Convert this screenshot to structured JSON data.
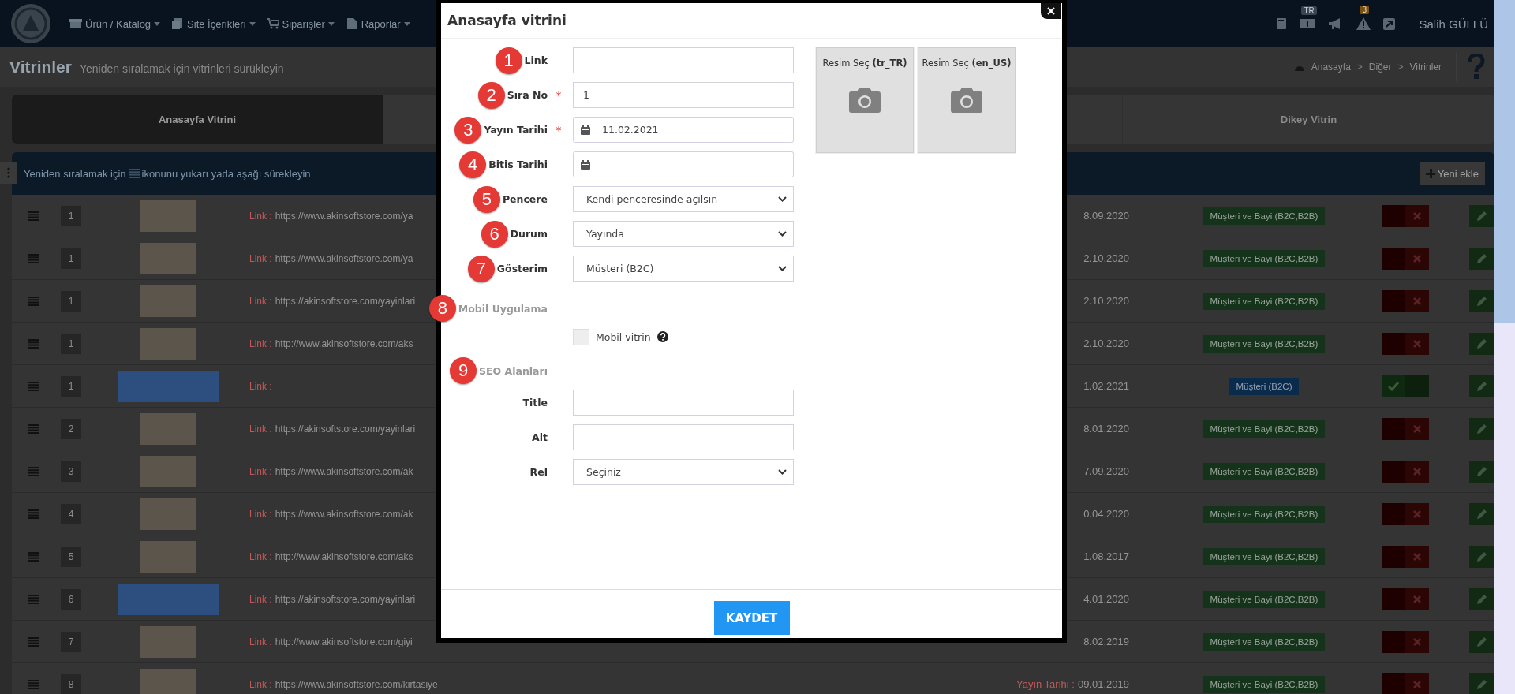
{
  "navbar": {
    "menu": [
      {
        "label": "Ürün / Katalog"
      },
      {
        "label": "Site İçerikleri"
      },
      {
        "label": "Siparişler"
      },
      {
        "label": "Raporlar"
      }
    ],
    "language_badge": "TR",
    "alert_count": "3",
    "user_name": "Salih GÜLLÜ"
  },
  "page_header": {
    "title": "Vitrinler",
    "subtitle": "Yeniden sıralamak için vitrinleri sürükleyin",
    "breadcrumb": {
      "items": [
        "Anasayfa",
        "Diğer",
        "Vitrinler"
      ],
      "separator": ">"
    }
  },
  "tabs": [
    {
      "label": "Anasayfa Vitrini",
      "selected": true
    },
    {
      "label": "Dikey Vitrin",
      "selected": false
    }
  ],
  "list_header": {
    "hint_before": "Yeniden sıralamak için",
    "hint_after": "ikonunu yukarı yada aşağı sürekleyin",
    "add_button": "Yeni ekle"
  },
  "rows": [
    {
      "order": "1",
      "kind": "image",
      "link_label": "Link :",
      "link": "https://www.akinsoftstore.com/ya",
      "date": "8.09.2020",
      "audience": "Müşteri ve Bayi (B2C,B2B)",
      "color": "#15321a",
      "active": false
    },
    {
      "order": "1",
      "kind": "image",
      "link_label": "Link :",
      "link": "https://www.akinsoftstore.com/ya",
      "date": "2.10.2020",
      "audience": "Müşteri ve Bayi (B2C,B2B)",
      "color": "#15321a",
      "active": false
    },
    {
      "order": "1",
      "kind": "image",
      "link_label": "Link :",
      "link": "https://akinsoftstore.com/yayinlari",
      "date": "2.10.2020",
      "audience": "Müşteri ve Bayi (B2C,B2B)",
      "color": "#15321a",
      "active": false
    },
    {
      "order": "1",
      "kind": "image",
      "link_label": "Link :",
      "link": "http://www.akinsoftstore.com/aks",
      "date": "2.10.2020",
      "audience": "Müşteri ve Bayi (B2C,B2B)",
      "color": "#15321a",
      "active": false
    },
    {
      "order": "1",
      "kind": "banner",
      "link_label": "Link :",
      "date": "1.02.2021",
      "audience": "Müşteri (B2C)",
      "color": "#0b2b4d",
      "active": true
    },
    {
      "order": "2",
      "kind": "image",
      "link_label": "Link :",
      "link": "https://akinsoftstore.com/yayinlari",
      "date": "8.01.2020",
      "audience": "Müşteri ve Bayi (B2C,B2B)",
      "color": "#15321a",
      "active": false
    },
    {
      "order": "3",
      "kind": "image",
      "link_label": "Link :",
      "link": "https://www.akinsoftstore.com/ak",
      "date": "7.09.2020",
      "audience": "Müşteri ve Bayi (B2C,B2B)",
      "color": "#15321a",
      "active": false
    },
    {
      "order": "4",
      "kind": "image",
      "link_label": "Link :",
      "link": "https://www.akinsoftstore.com/ak",
      "date": "0.04.2020",
      "audience": "Müşteri ve Bayi (B2C,B2B)",
      "color": "#15321a",
      "active": false
    },
    {
      "order": "5",
      "kind": "image",
      "link_label": "Link :",
      "link": "http://www.akinsoftstore.com/aks",
      "date": "1.08.2017",
      "audience": "Müşteri ve Bayi (B2C,B2B)",
      "color": "#15321a",
      "active": false
    },
    {
      "order": "6",
      "kind": "banner",
      "link_label": "Link :",
      "link": "https://akinsoftstore.com/yayinlari",
      "date": "4.01.2020",
      "audience": "Müşteri ve Bayi (B2C,B2B)",
      "color": "#15321a",
      "active": false
    },
    {
      "order": "7",
      "kind": "image",
      "link_label": "Link :",
      "link": "http://www.akinsoftstore.com/giyi",
      "date": "8.02.2019",
      "audience": "Müşteri ve Bayi (B2C,B2B)",
      "color": "#15321a",
      "active": false
    },
    {
      "order": "8",
      "kind": "image",
      "link_label": "Link :",
      "link": "https://www.akinsoftstore.com/kirtasiye",
      "date_label": "Yayın Tarihi :",
      "date": "09.01.2019",
      "audience": "Müşteri ve Bayi (B2C,B2B)",
      "color": "#15321a",
      "active": false
    }
  ],
  "dialog": {
    "title": "Anasayfa vitrini",
    "required_mark": "*",
    "fields": [
      {
        "kind": "text",
        "marker": "1",
        "label": "Link",
        "required": false
      },
      {
        "kind": "text",
        "marker": "2",
        "label": "Sıra No",
        "required": true,
        "value": "1"
      },
      {
        "kind": "date",
        "marker": "3",
        "label": "Yayın Tarihi",
        "required": true,
        "value": "11.02.2021"
      },
      {
        "kind": "date",
        "marker": "4",
        "label": "Bitiş Tarihi",
        "required": false
      },
      {
        "kind": "select",
        "marker": "5",
        "label": "Pencere",
        "required": false,
        "value": "Kendi penceresinde açılsın"
      },
      {
        "kind": "select",
        "marker": "6",
        "label": "Durum",
        "required": false,
        "value": "Yayında"
      },
      {
        "kind": "select",
        "marker": "7",
        "label": "Gösterim",
        "required": false,
        "value": "Müşteri (B2C)"
      },
      {
        "kind": "section",
        "marker": "8",
        "label": "Mobil Uygulama"
      },
      {
        "kind": "checkbox",
        "label": "Mobil vitrin",
        "checked": false,
        "help": true
      },
      {
        "kind": "section",
        "marker": "9",
        "label": "SEO Alanları"
      },
      {
        "kind": "text",
        "label": "Title",
        "required": false
      },
      {
        "kind": "text",
        "label": "Alt",
        "required": false
      },
      {
        "kind": "select",
        "label": "Rel",
        "required": false,
        "value": "Seçiniz"
      }
    ],
    "image_pickers": [
      {
        "label": "Resim Seç **(tr_TR)**"
      },
      {
        "label": "Resim Seç **(en_US)**"
      }
    ],
    "save_button": "KAYDET"
  }
}
